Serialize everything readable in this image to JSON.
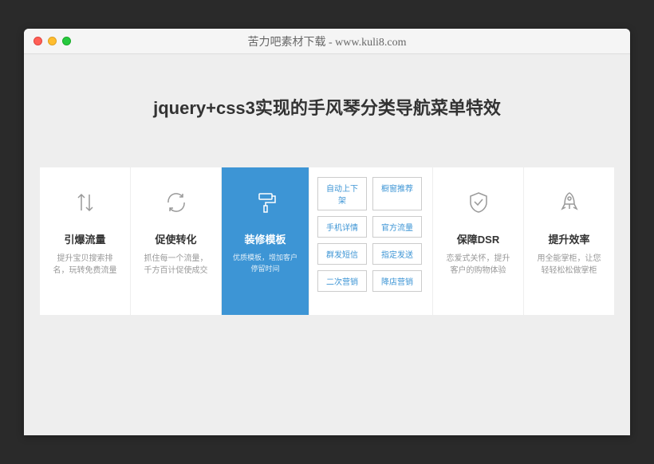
{
  "window": {
    "title": "苦力吧素材下载 - www.kuli8.com"
  },
  "heading": "jquery+css3实现的手风琴分类导航菜单特效",
  "panels": [
    {
      "title": "引爆流量",
      "desc": "提升宝贝搜索排名，玩转免费流量"
    },
    {
      "title": "促使转化",
      "desc": "抓住每一个流量，千方百计促使成交"
    },
    {
      "title": "装修模板",
      "desc": "优质模板，增加客户停留时间"
    },
    {
      "title": "保障DSR",
      "desc": "恋爱式关怀，提升客户的购物体验"
    },
    {
      "title": "提升效率",
      "desc": "用全能掌柜，让您轻轻松松做掌柜"
    }
  ],
  "tags": [
    "自动上下架",
    "橱窗推荐",
    "手机详情",
    "官方流量",
    "群发短信",
    "指定发送",
    "二次营销",
    "降店营销"
  ]
}
